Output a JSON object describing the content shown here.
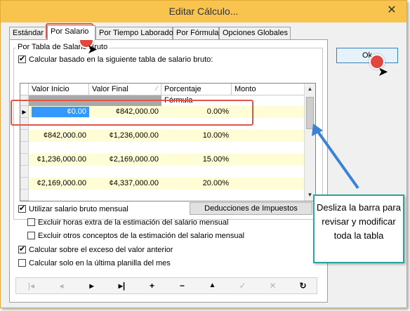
{
  "window": {
    "title": "Editar Cálculo...",
    "close_glyph": "✕"
  },
  "tabs": [
    {
      "label": "Estándar"
    },
    {
      "label": "Por Salario"
    },
    {
      "label": "Por Tiempo Laborado"
    },
    {
      "label": "Por Fórmula"
    },
    {
      "label": "Opciones Globales"
    }
  ],
  "group": {
    "legend": "Por Tabla de Salario Bruto",
    "calc_checkbox_label": "Calcular basado en la siguiente tabla de salario bruto:",
    "calc_checked": true
  },
  "grid": {
    "columns": [
      "Valor Inicio",
      "Valor Final",
      "Porcentaje",
      "Monto"
    ],
    "formula_label": "Fórmula",
    "current_row_marker": "▶",
    "rows": [
      {
        "start": "¢0.00",
        "end": "¢842,000.00",
        "percent": "0.00%",
        "amount": ""
      },
      {
        "start": "¢842,000.00",
        "end": "¢1,236,000.00",
        "percent": "10.00%",
        "amount": ""
      },
      {
        "start": "¢1,236,000.00",
        "end": "¢2,169,000.00",
        "percent": "15.00%",
        "amount": ""
      },
      {
        "start": "¢2,169,000.00",
        "end": "¢4,337,000.00",
        "percent": "20.00%",
        "amount": ""
      }
    ],
    "scroll_up": "▲",
    "scroll_down": "▼"
  },
  "options": {
    "monthly": {
      "label": "Utilizar salario bruto mensual",
      "checked": true
    },
    "exclude_overtime": {
      "label": "Excluir horas extra de la estimación del salario mensual",
      "checked": false
    },
    "exclude_other": {
      "label": "Excluir otros conceptos de la estimación del salario mensual",
      "checked": false
    },
    "excess": {
      "label": "Calcular sobre el exceso del valor anterior",
      "checked": true
    },
    "last_payroll": {
      "label": "Calcular solo en la última planilla del mes",
      "checked": false
    }
  },
  "deductions_button": "Deducciones de Impuestos",
  "ok_button": "Ok",
  "navigator": [
    {
      "name": "first-record-button",
      "glyph": "|◂",
      "enabled": false
    },
    {
      "name": "prior-record-button",
      "glyph": "◂",
      "enabled": false
    },
    {
      "name": "next-record-button",
      "glyph": "▸",
      "enabled": true
    },
    {
      "name": "last-record-button",
      "glyph": "▸|",
      "enabled": true
    },
    {
      "name": "insert-record-button",
      "glyph": "+",
      "enabled": true
    },
    {
      "name": "delete-record-button",
      "glyph": "−",
      "enabled": true
    },
    {
      "name": "edit-record-button",
      "glyph": "▲",
      "enabled": true
    },
    {
      "name": "post-record-button",
      "glyph": "✓",
      "enabled": false
    },
    {
      "name": "cancel-record-button",
      "glyph": "✕",
      "enabled": false
    },
    {
      "name": "refresh-button",
      "glyph": "↻",
      "enabled": true
    }
  ],
  "callout": {
    "text": "Desliza la barra para revisar y modificar toda la tabla"
  },
  "colors": {
    "title_bar": "#f9c44d",
    "row_band": "#fffdd6",
    "highlight": "#e05546",
    "callout_border": "#2aa39a",
    "arrow": "#3a82d6"
  }
}
